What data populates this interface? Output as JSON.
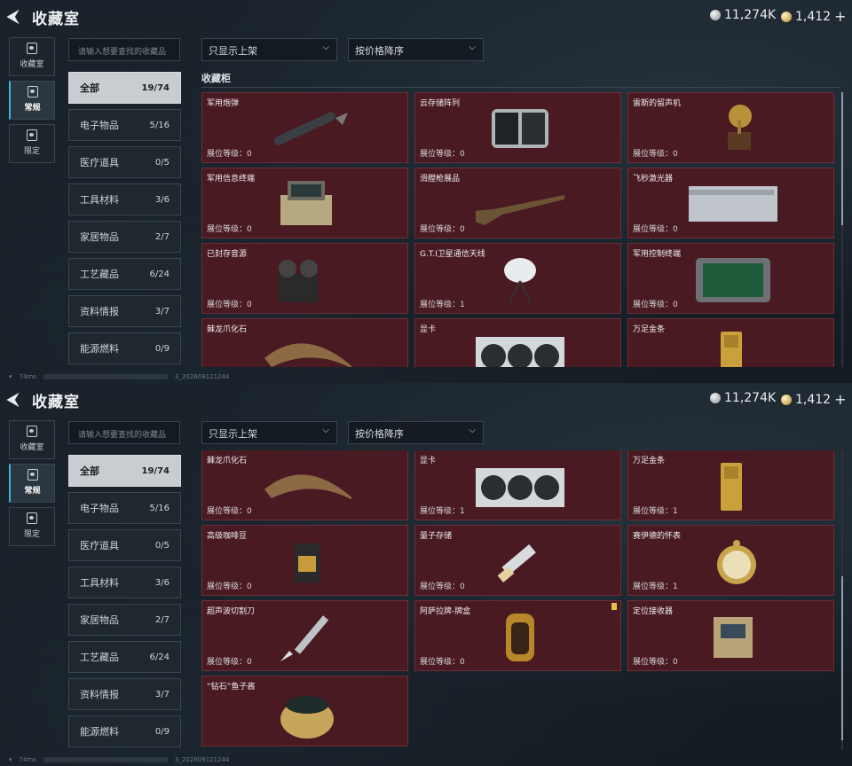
{
  "header": {
    "title": "收藏室",
    "currency_silver": "11,274K",
    "currency_gold": "1,412",
    "plus": "+"
  },
  "sidenav": [
    {
      "label": "收藏室",
      "icon": "collection-room-icon"
    },
    {
      "label": "常规",
      "icon": "regular-icon"
    },
    {
      "label": "限定",
      "icon": "limited-icon"
    }
  ],
  "search": {
    "placeholder": "请输入想要查找的收藏品"
  },
  "filters": {
    "shelf": "只显示上架",
    "sort": "按价格降序"
  },
  "section_title": "收藏柜",
  "categories": [
    {
      "label": "全部",
      "count": "19/74"
    },
    {
      "label": "电子物品",
      "count": "5/16"
    },
    {
      "label": "医疗道具",
      "count": "0/5"
    },
    {
      "label": "工具材料",
      "count": "3/6"
    },
    {
      "label": "家居物品",
      "count": "2/7"
    },
    {
      "label": "工艺藏品",
      "count": "6/24"
    },
    {
      "label": "资料情报",
      "count": "3/7"
    },
    {
      "label": "能源燃料",
      "count": "0/9"
    }
  ],
  "level_label": "展位等级：",
  "items": [
    {
      "name": "军用炮弹",
      "level": "0"
    },
    {
      "name": "云存储阵列",
      "level": "0"
    },
    {
      "name": "雷斯的留声机",
      "level": "0"
    },
    {
      "name": "军用信息终端",
      "level": "0"
    },
    {
      "name": "滑膛枪展品",
      "level": "0"
    },
    {
      "name": "飞秒激光器",
      "level": "0"
    },
    {
      "name": "已封存音源",
      "level": "0"
    },
    {
      "name": "G.T.I卫星通信天线",
      "level": "1"
    },
    {
      "name": "军用控制终端",
      "level": "0"
    },
    {
      "name": "棘龙爪化石",
      "level": "0"
    },
    {
      "name": "显卡",
      "level": "1"
    },
    {
      "name": "万足金条",
      "level": "1"
    },
    {
      "name": "高级咖啡豆",
      "level": "0"
    },
    {
      "name": "量子存储",
      "level": "0"
    },
    {
      "name": "赛伊德的怀表",
      "level": "1"
    },
    {
      "name": "超声波切割刀",
      "level": "0"
    },
    {
      "name": "阿萨拉牌-牌盒",
      "level": "0"
    },
    {
      "name": "定位接收器",
      "level": "0"
    },
    {
      "name": "“钻石”鱼子酱",
      "level": ""
    }
  ],
  "footer": {
    "ping": "74ms",
    "build": "3_202609121244"
  },
  "colors": {
    "card_bg": "#4a1a22",
    "card_border": "#6b2e38",
    "accent": "#3fb3d8"
  }
}
